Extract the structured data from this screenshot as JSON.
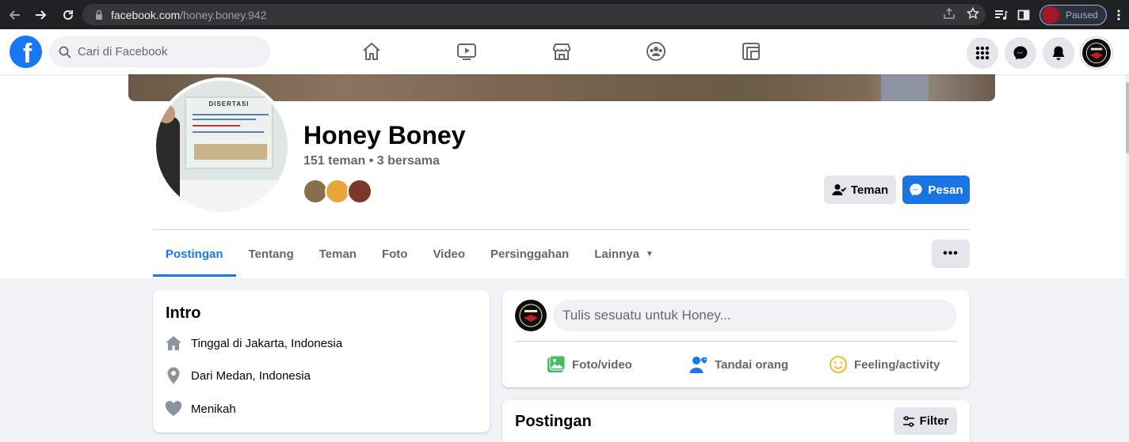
{
  "browser": {
    "url_host": "facebook.com",
    "url_path": "/honey.boney.942",
    "paused_label": "Paused"
  },
  "fb_header": {
    "logo_letter": "f",
    "search_placeholder": "Cari di Facebook"
  },
  "profile": {
    "name": "Honey Boney",
    "friends_line": "151 teman • 3 bersama",
    "poster_title": "DISERTASI",
    "friend_button": "Teman",
    "message_button": "Pesan",
    "mutual_colors": [
      "#8a6d4a",
      "#e8a63a",
      "#7a3a2a"
    ]
  },
  "tabs": [
    {
      "label": "Postingan",
      "active": true
    },
    {
      "label": "Tentang",
      "active": false
    },
    {
      "label": "Teman",
      "active": false
    },
    {
      "label": "Foto",
      "active": false
    },
    {
      "label": "Video",
      "active": false
    },
    {
      "label": "Persinggahan",
      "active": false
    },
    {
      "label": "Lainnya",
      "active": false
    }
  ],
  "more_button": "•••",
  "intro": {
    "title": "Intro",
    "lives_prefix": "Tinggal di ",
    "lives_place": "Jakarta, Indonesia",
    "from_prefix": "Dari ",
    "from_place": "Medan, Indonesia",
    "relationship": "Menikah"
  },
  "composer": {
    "placeholder": "Tulis sesuatu untuk Honey...",
    "actions": {
      "photo": "Foto/video",
      "tag": "Tandai orang",
      "feeling": "Feeling/activity"
    }
  },
  "posts_section": {
    "title": "Postingan",
    "filter": "Filter"
  },
  "colors": {
    "fb_blue": "#1877f2",
    "photo_green": "#45bd62",
    "tag_blue": "#1877f2",
    "feeling_yellow": "#f7b928"
  }
}
